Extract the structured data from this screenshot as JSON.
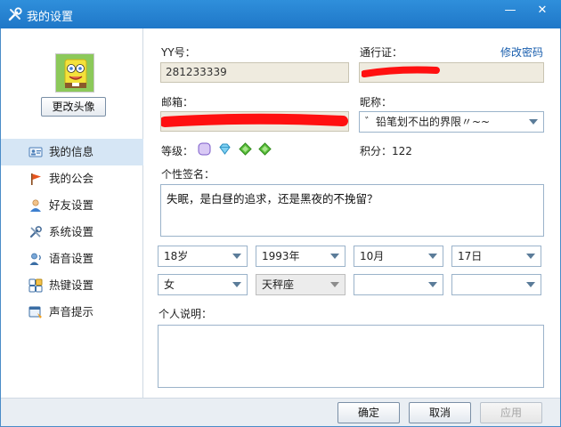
{
  "window": {
    "title": "我的设置",
    "title_icon": "tools-icon",
    "minimize_glyph": "—",
    "close_glyph": "✕",
    "accent_color": "#1f77c8"
  },
  "sidebar": {
    "change_avatar_label": "更改头像",
    "items": [
      {
        "label": "我的信息",
        "icon": "user-card-icon",
        "active": true
      },
      {
        "label": "我的公会",
        "icon": "flag-icon",
        "active": false
      },
      {
        "label": "好友设置",
        "icon": "friend-icon",
        "active": false
      },
      {
        "label": "系统设置",
        "icon": "tools-icon",
        "active": false
      },
      {
        "label": "语音设置",
        "icon": "voice-icon",
        "active": false
      },
      {
        "label": "热键设置",
        "icon": "hotkey-icon",
        "active": false
      },
      {
        "label": "声音提示",
        "icon": "sound-icon",
        "active": false
      }
    ]
  },
  "profile": {
    "yy_label": "YY号：",
    "yy_value": "281233339",
    "passport_label": "通行证：",
    "change_password_link": "修改密码",
    "email_label": "邮箱：",
    "nickname_label": "昵称：",
    "nickname_value": "゛铅笔划不出的界限〃~~",
    "level_label": "等级：",
    "level_badges": [
      "moon-badge-icon",
      "diamond-badge-icon",
      "star-badge-icon",
      "star-badge-icon"
    ],
    "points_label": "积分：",
    "points_value": "122",
    "signature_label": "个性签名：",
    "signature_value": "失眠，是白昼的追求，还是黑夜的不挽留？",
    "age": "18岁",
    "birth_year": "1993年",
    "birth_month": "10月",
    "birth_day": "17日",
    "gender": "女",
    "zodiac": "天秤座",
    "province": "",
    "city": "",
    "description_label": "个人说明：",
    "description_value": ""
  },
  "footer": {
    "ok_label": "确定",
    "cancel_label": "取消",
    "apply_label": "应用"
  }
}
